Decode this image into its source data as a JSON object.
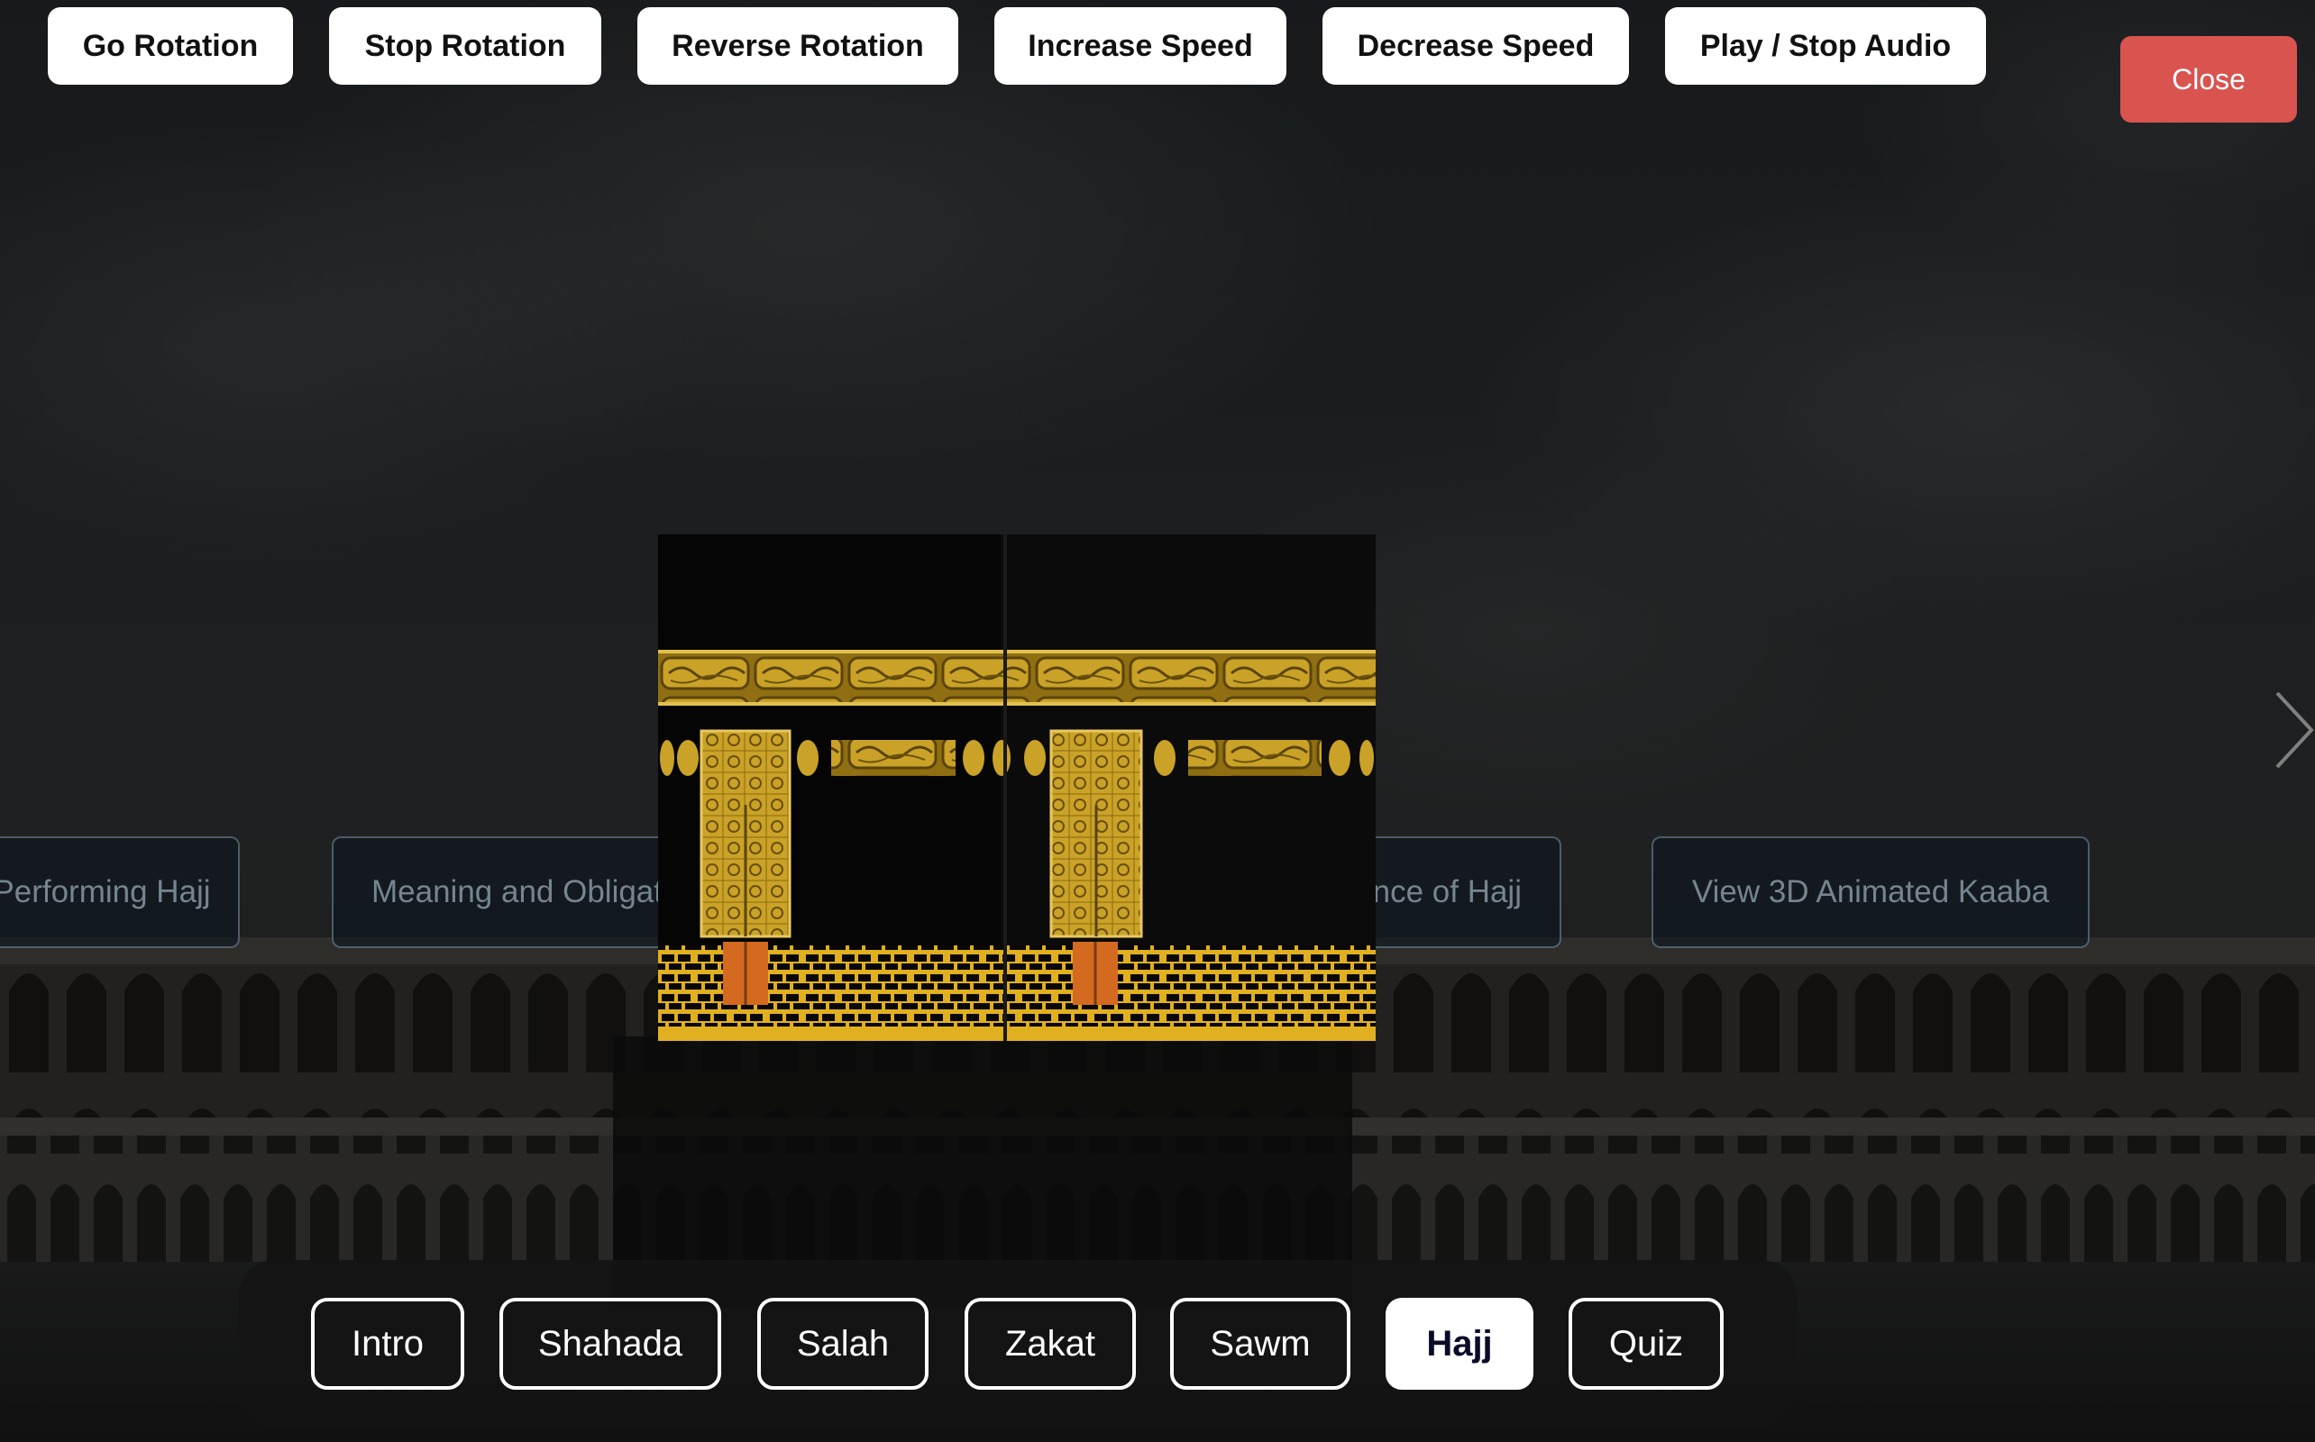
{
  "controls": {
    "go_rotation": "Go Rotation",
    "stop_rotation": "Stop Rotation",
    "reverse_rotation": "Reverse Rotation",
    "increase_speed": "Increase Speed",
    "decrease_speed": "Decrease Speed",
    "play_stop_audio": "Play / Stop Audio"
  },
  "close_label": "Close",
  "carousel": {
    "cards": [
      "Performing Hajj",
      "Meaning and Obligation",
      "Virtues, Impact and Importance of Hajj",
      "View 3D Animated Kaaba"
    ],
    "next_icon": "chevron-right-icon"
  },
  "nav": {
    "tabs": [
      "Intro",
      "Shahada",
      "Salah",
      "Zakat",
      "Sawm",
      "Hajj",
      "Quiz"
    ],
    "active": "Hajj"
  },
  "colors": {
    "close_bg": "#d9534f",
    "button_bg": "#ffffff",
    "active_tab_bg": "#ffffff",
    "kiswa_gold": "#c9a227"
  }
}
